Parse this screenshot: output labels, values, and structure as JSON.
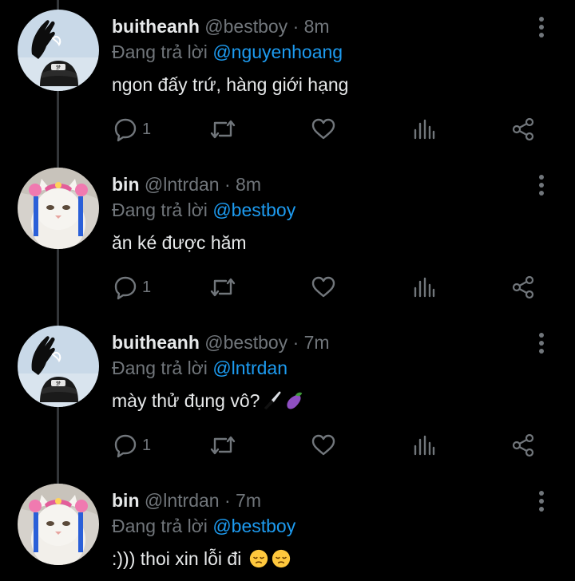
{
  "colors": {
    "background": "#000000",
    "text_primary": "#e7e9ea",
    "text_secondary": "#71767b",
    "mention": "#1d9bf0",
    "thread_line": "#333639"
  },
  "icons": {
    "more": "more-vertical-icon",
    "reply": "reply-bubble-icon",
    "retweet": "retweet-icon",
    "like": "heart-icon",
    "views": "bar-chart-icon",
    "share": "share-icon"
  },
  "replying_prefix": "Đang trả lời",
  "tweets": [
    {
      "display_name": "buitheanh",
      "handle": "@bestboy",
      "time": "8m",
      "replying_to": "@nguyenhoang",
      "text": "ngon đấy trứ, hàng giới hạng",
      "reply_count": "1",
      "avatar": "helmet-hand-avatar"
    },
    {
      "display_name": "bin",
      "handle": "@lntrdan",
      "time": "8m",
      "replying_to": "@bestboy",
      "text": "ăn ké được hăm",
      "reply_count": "1",
      "avatar": "white-cat-costume-avatar"
    },
    {
      "display_name": "buitheanh",
      "handle": "@bestboy",
      "time": "7m",
      "replying_to": "@lntrdan",
      "text": "mày thử đụng vô?",
      "emojis": [
        "knife",
        "eggplant"
      ],
      "reply_count": "1",
      "avatar": "helmet-hand-avatar"
    },
    {
      "display_name": "bin",
      "handle": "@lntrdan",
      "time": "7m",
      "replying_to": "@bestboy",
      "text": ":))) thoi xin lỗi đi",
      "emojis": [
        "pensive-face",
        "pensive-face"
      ],
      "reply_count": "",
      "avatar": "white-cat-costume-avatar"
    }
  ]
}
